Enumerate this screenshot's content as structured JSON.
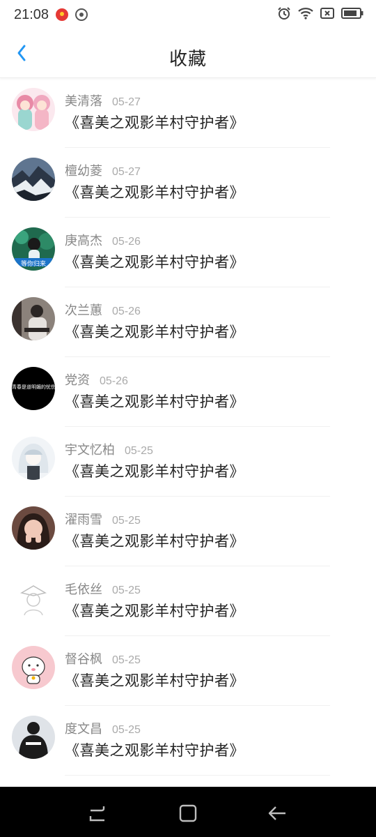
{
  "status_bar": {
    "time": "21:08"
  },
  "header": {
    "title": "收藏"
  },
  "favorites": [
    {
      "name": "美清落",
      "date": "05-27",
      "title": "《喜美之观影羊村守护者》",
      "avatar_bg": "#f6d6df",
      "avatar_accent": "#e88aa6"
    },
    {
      "name": "檀幼菱",
      "date": "05-27",
      "title": "《喜美之观影羊村守护者》",
      "avatar_bg": "#3b4d63",
      "avatar_accent": "#e9eef2"
    },
    {
      "name": "庚高杰",
      "date": "05-26",
      "title": "《喜美之观影羊村守护者》",
      "avatar_bg": "#1f6a4e",
      "avatar_accent": "#5bd5a8",
      "avatar_text": "等你归来"
    },
    {
      "name": "次兰蕙",
      "date": "05-26",
      "title": "《喜美之观影羊村守护者》",
      "avatar_bg": "#7a716a",
      "avatar_accent": "#2b2624"
    },
    {
      "name": "党资",
      "date": "05-26",
      "title": "《喜美之观影羊村守护者》",
      "avatar_bg": "#000000",
      "avatar_accent": "#ffffff",
      "avatar_text": "青春是道明媚的忧伤"
    },
    {
      "name": "宇文忆柏",
      "date": "05-25",
      "title": "《喜美之观影羊村守护者》",
      "avatar_bg": "#eef1f4",
      "avatar_accent": "#9aa7b3"
    },
    {
      "name": "濯雨雪",
      "date": "05-25",
      "title": "《喜美之观影羊村守护者》",
      "avatar_bg": "#5a3a33",
      "avatar_accent": "#f0c9b8"
    },
    {
      "name": "毛依丝",
      "date": "05-25",
      "title": "《喜美之观影羊村守护者》",
      "avatar_bg": "#ffffff",
      "avatar_accent": "#c8c8c8"
    },
    {
      "name": "督谷枫",
      "date": "05-25",
      "title": "《喜美之观影羊村守护者》",
      "avatar_bg": "#f7c9cf",
      "avatar_accent": "#ffffff"
    },
    {
      "name": "度文昌",
      "date": "05-25",
      "title": "《喜美之观影羊村守护者》",
      "avatar_bg": "#dfe3e8",
      "avatar_accent": "#1c1c1c"
    }
  ],
  "colors": {
    "accent": "#2196f3",
    "nav_bg": "#000000"
  },
  "icons": {
    "back": "chevron-left-icon",
    "alarm": "alarm-icon",
    "wifi": "wifi-icon",
    "sim": "sim-card-icon",
    "battery": "battery-icon",
    "recents": "recents-icon",
    "home": "home-icon",
    "nav_back": "back-arrow-icon"
  }
}
